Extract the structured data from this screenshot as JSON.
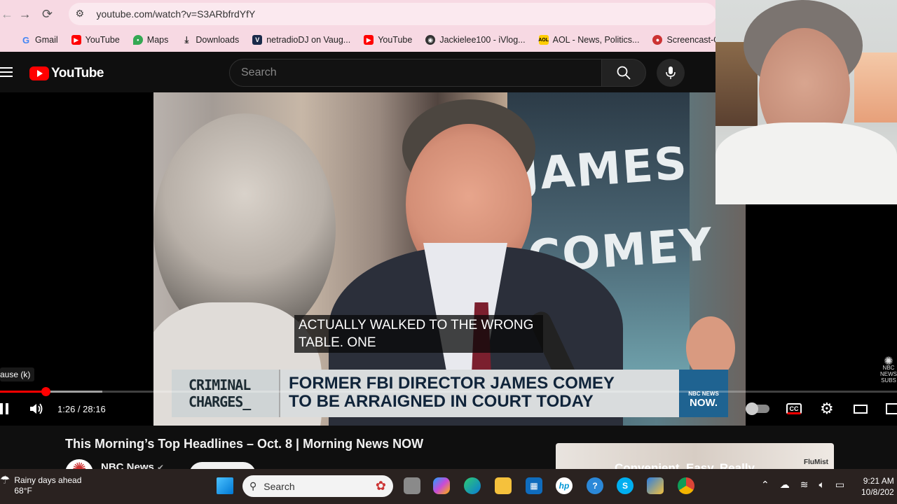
{
  "browser": {
    "url": "youtube.com/watch?v=S3ARbfrdYfY",
    "bookmarks": [
      {
        "label": "Gmail",
        "icon": "google-icon"
      },
      {
        "label": "YouTube",
        "icon": "youtube-icon"
      },
      {
        "label": "Maps",
        "icon": "maps-pin-icon"
      },
      {
        "label": "Downloads",
        "icon": "download-icon"
      },
      {
        "label": "netradioDJ on Vaug...",
        "icon": "netradio-icon"
      },
      {
        "label": "YouTube",
        "icon": "youtube-icon"
      },
      {
        "label": "Jackielee100 - iVlog...",
        "icon": "vlog-icon"
      },
      {
        "label": "AOL - News, Politics...",
        "icon": "aol-icon"
      },
      {
        "label": "Screencast-O-Matic...",
        "icon": "screencast-icon"
      }
    ]
  },
  "youtube": {
    "logo_text": "YouTube",
    "search_placeholder": "Search"
  },
  "video": {
    "caption_line1": "ACTUALLY WALKED TO THE WRONG",
    "caption_line2": "TABLE. ONE",
    "poster_text": "JAMES\nCOMEY",
    "lower_third_tag_line1": "CRIMINAL",
    "lower_third_tag_line2": "CHARGES_",
    "lower_third_headline_line1": "FORMER FBI DIRECTOR JAMES COMEY",
    "lower_third_headline_line2": "TO BE ARRAIGNED IN COURT TODAY",
    "network_logo_line1": "NBC NEWS",
    "network_logo_line2": "NOW.",
    "watermark_line1": "NBC",
    "watermark_line2": "NEWS",
    "watermark_line3": "SUBS",
    "tooltip": "ause (k)",
    "time_display": "1:26 / 28:16",
    "progress_fraction": 0.0509,
    "buffer_fraction": 0.114,
    "title": "This Morning’s Top Headlines – Oct. 8 | Morning News NOW",
    "channel": "NBC News",
    "ad_text": "Convenient. Easy. Really.",
    "ad_brand": "FluMist"
  },
  "taskbar": {
    "weather_line1": "Rainy days ahead",
    "weather_line2": "68°F",
    "search_placeholder": "Search",
    "time": "9:21 AM",
    "date": "10/8/202"
  },
  "colors": {
    "browser_chrome": "#f7d9e3",
    "youtube_red": "#ff0000",
    "taskbar": "#2a2220"
  }
}
